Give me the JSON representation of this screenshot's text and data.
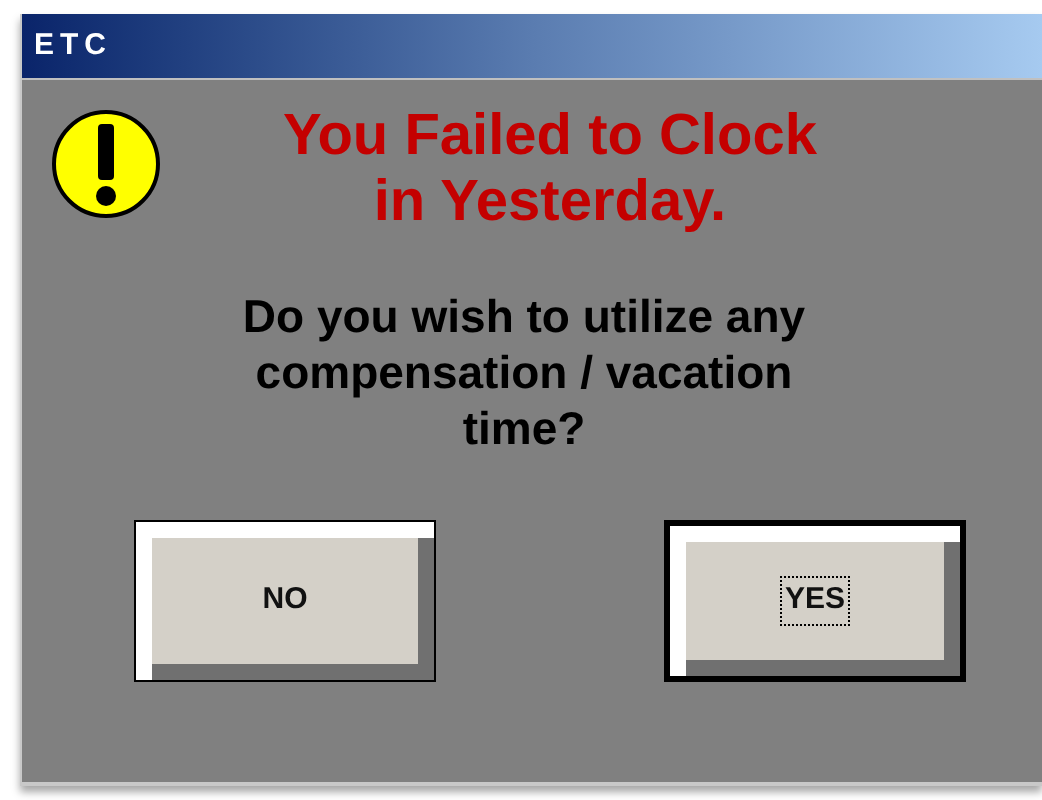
{
  "window": {
    "title": "ETC"
  },
  "message": {
    "heading_lines": [
      "You Failed to Clock",
      "in Yesterday."
    ],
    "question_lines": [
      "Do you wish to utilize any",
      "compensation / vacation",
      "time?"
    ]
  },
  "buttons": [
    {
      "label": "NO",
      "default": false
    },
    {
      "label": "YES",
      "default": true
    }
  ]
}
